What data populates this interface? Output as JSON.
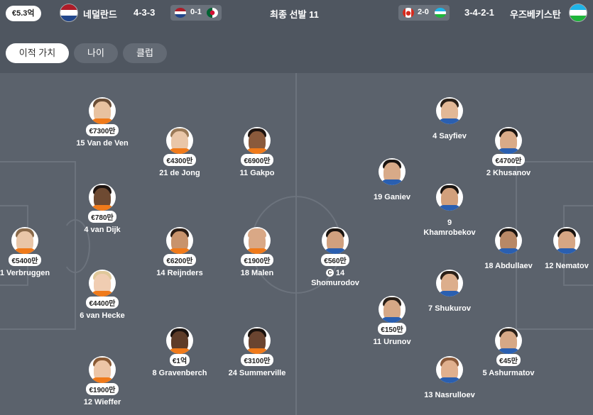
{
  "header": {
    "total_value": "€5.3억",
    "home_team": "네덜란드",
    "home_formation": "4-3-3",
    "home_prev_score": "0-1",
    "title": "최종 선발 11",
    "away_prev_score": "2-0",
    "away_formation": "3-4-2-1",
    "away_team": "우즈베키스탄"
  },
  "tabs": [
    {
      "label": "이적 가치",
      "active": true
    },
    {
      "label": "나이",
      "active": false
    },
    {
      "label": "클럽",
      "active": false
    }
  ],
  "home_players": [
    {
      "name": "1 Verbruggen",
      "value": "€5400만"
    },
    {
      "name": "15 Van de Ven",
      "value": "€7300만"
    },
    {
      "name": "4 van Dijk",
      "value": "€780만"
    },
    {
      "name": "6 van Hecke",
      "value": "€4400만"
    },
    {
      "name": "12 Wieffer",
      "value": "€1900만"
    },
    {
      "name": "21 de Jong",
      "value": "€4300만"
    },
    {
      "name": "14 Reijnders",
      "value": "€6200만"
    },
    {
      "name": "8 Gravenberch",
      "value": "€1억"
    },
    {
      "name": "11 Gakpo",
      "value": "€6900만"
    },
    {
      "name": "18 Malen",
      "value": "€1900만"
    },
    {
      "name": "24 Summerville",
      "value": "€3100만"
    }
  ],
  "away_players": [
    {
      "name": "12 Nematov",
      "value": ""
    },
    {
      "name": "2 Khusanov",
      "value": "€4700만"
    },
    {
      "name": "18 Abdullaev",
      "value": ""
    },
    {
      "name": "5 Ashurmatov",
      "value": "€45만"
    },
    {
      "name": "4 Sayfiev",
      "value": ""
    },
    {
      "name": "9 Khamrobekov",
      "value": ""
    },
    {
      "name": "7 Shukurov",
      "value": ""
    },
    {
      "name": "13 Nasrulloev",
      "value": ""
    },
    {
      "name": "19 Ganiev",
      "value": ""
    },
    {
      "name": "11 Urunov",
      "value": "€150만"
    },
    {
      "name": "14 Shomurodov",
      "value": "€560만",
      "captain": true
    }
  ],
  "captain_badge": "C",
  "colors": {
    "background": "#4f5660",
    "pitch": "#5b626c",
    "pitch_lines": "#6c737d"
  }
}
